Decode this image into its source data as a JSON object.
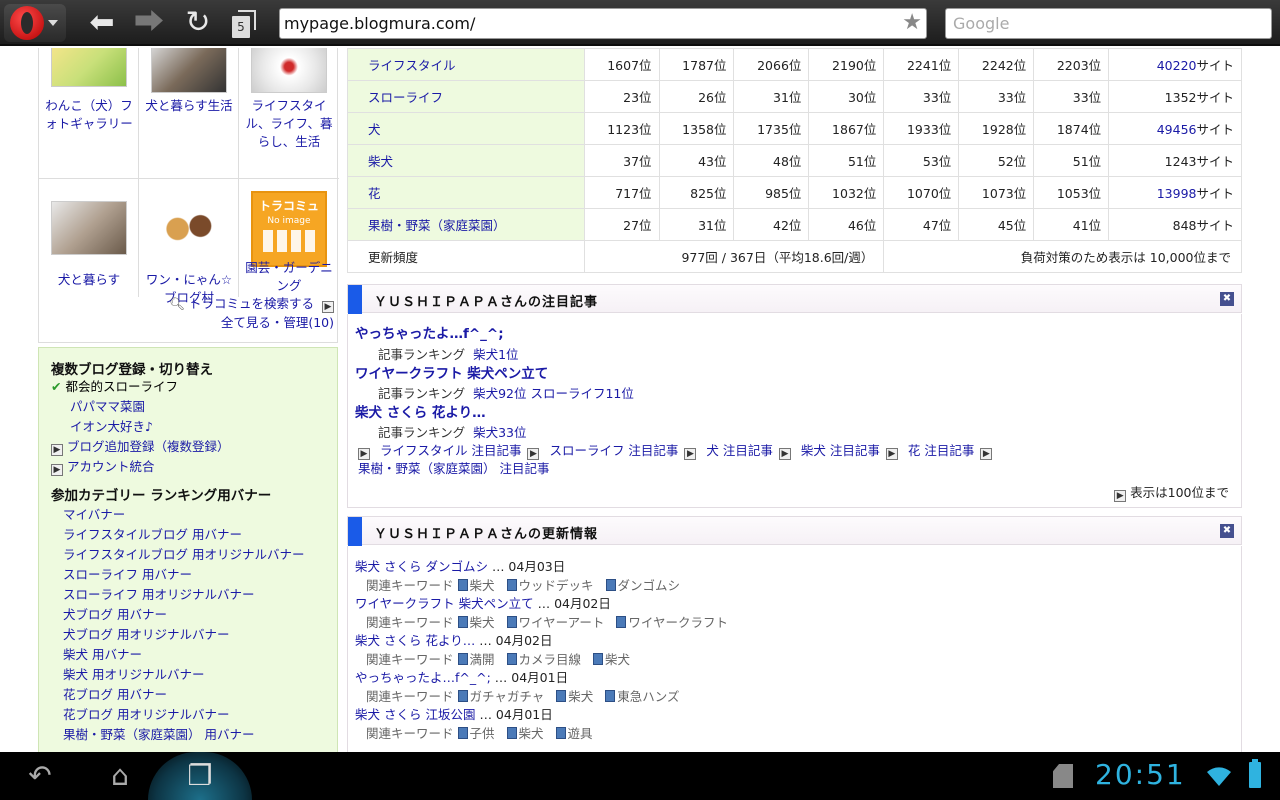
{
  "browser": {
    "tab_count": "5",
    "url": "mypage.blogmura.com/",
    "search_placeholder": "Google"
  },
  "tracomi": {
    "items": [
      {
        "label": "わんこ（犬）フォトギャラリー"
      },
      {
        "label": "犬と暮らす生活"
      },
      {
        "label": "ライフスタイル、ライフ、暮らし、生活"
      },
      {
        "label": "犬と暮らす"
      },
      {
        "label": "ワン・にゃん☆ブログ村"
      },
      {
        "label": "園芸・ガーデニング",
        "thumb_text": "トラコミュ",
        "thumb_sub": "No image"
      }
    ],
    "search_link": "トラコミュを検索する",
    "manage_link": "全て見る・管理(10)"
  },
  "side": {
    "blog_title": "複数ブログ登録・切り替え",
    "blogs": [
      "都会的スローライフ",
      "パパママ菜園",
      "イオン大好き♪"
    ],
    "add_blog": "ブログ追加登録（複数登録）",
    "account_merge": "アカウント統合",
    "banner_title": "参加カテゴリー ランキング用バナー",
    "banners": [
      "マイバナー",
      "ライフスタイルブログ 用バナー",
      "ライフスタイルブログ 用オリジナルバナー",
      "スローライフ 用バナー",
      "スローライフ 用オリジナルバナー",
      "犬ブログ 用バナー",
      "犬ブログ 用オリジナルバナー",
      "柴犬 用バナー",
      "柴犬 用オリジナルバナー",
      "花ブログ 用バナー",
      "花ブログ 用オリジナルバナー",
      "果樹・野菜（家庭菜園） 用バナー"
    ]
  },
  "ranking": {
    "rows": [
      {
        "cat": "ライフスタイル",
        "vals": [
          "1607位",
          "1787位",
          "2066位",
          "2190位",
          "2241位",
          "2242位",
          "2203位"
        ],
        "sites": "40220",
        "sites_linked": true
      },
      {
        "cat": "スローライフ",
        "vals": [
          "23位",
          "26位",
          "31位",
          "30位",
          "33位",
          "33位",
          "33位"
        ],
        "sites": "1352",
        "sites_linked": false
      },
      {
        "cat": "犬",
        "vals": [
          "1123位",
          "1358位",
          "1735位",
          "1867位",
          "1933位",
          "1928位",
          "1874位"
        ],
        "sites": "49456",
        "sites_linked": true
      },
      {
        "cat": "柴犬",
        "vals": [
          "37位",
          "43位",
          "48位",
          "51位",
          "53位",
          "52位",
          "51位"
        ],
        "sites": "1243",
        "sites_linked": false
      },
      {
        "cat": "花",
        "vals": [
          "717位",
          "825位",
          "985位",
          "1032位",
          "1070位",
          "1073位",
          "1053位"
        ],
        "sites": "13998",
        "sites_linked": true
      },
      {
        "cat": "果樹・野菜（家庭菜園）",
        "vals": [
          "27位",
          "31位",
          "42位",
          "46位",
          "47位",
          "45位",
          "41位"
        ],
        "sites": "848",
        "sites_linked": false
      }
    ],
    "site_suffix": "サイト",
    "freq_label": "更新頻度",
    "freq_value": "977回 / 367日（平均18.6回/週）",
    "load_note": "負荷対策のため表示は 10,000位まで"
  },
  "featured": {
    "title": "ＹＵＳＨＩＰＡＰＡさんの注目記事",
    "articles": [
      {
        "title": "やっちゃったよ…f^_^;",
        "rank_label": "記事ランキング",
        "rank": "柴犬1位"
      },
      {
        "title": "ワイヤークラフト 柴犬ペン立て",
        "rank_label": "記事ランキング",
        "rank": "柴犬92位 スローライフ11位"
      },
      {
        "title": "柴犬 さくら 花より…",
        "rank_label": "記事ランキング",
        "rank": "柴犬33位"
      }
    ],
    "cat_links": [
      "ライフスタイル 注目記事",
      "スローライフ 注目記事",
      "犬 注目記事",
      "柴犬 注目記事",
      "花 注目記事"
    ],
    "cat_link_last": "果樹・野菜（家庭菜園） 注目記事",
    "show_note": "表示は100位まで"
  },
  "updates": {
    "title": "ＹＵＳＨＩＰＡＰＡさんの更新情報",
    "kw_label": "関連キーワード",
    "items": [
      {
        "title": "柴犬 さくら ダンゴムシ",
        "date": "… 04月03日",
        "kw": [
          "柴犬",
          "ウッドデッキ",
          "ダンゴムシ"
        ]
      },
      {
        "title": "ワイヤークラフト 柴犬ペン立て",
        "date": "… 04月02日",
        "kw": [
          "柴犬",
          "ワイヤーアート",
          "ワイヤークラフト"
        ]
      },
      {
        "title": "柴犬 さくら 花より…",
        "date": "… 04月02日",
        "kw": [
          "満開",
          "カメラ目線",
          "柴犬"
        ]
      },
      {
        "title": "やっちゃったよ…f^_^;",
        "date": "… 04月01日",
        "kw": [
          "ガチャガチャ",
          "柴犬",
          "東急ハンズ"
        ]
      },
      {
        "title": "柴犬 さくら 江坂公園",
        "date": "… 04月01日",
        "kw": [
          "子供",
          "柴犬",
          "遊具"
        ]
      }
    ]
  },
  "system": {
    "clock": "20:51"
  }
}
